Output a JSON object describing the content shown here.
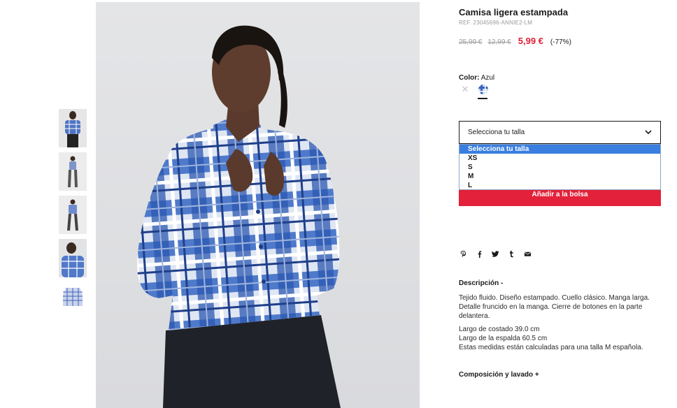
{
  "product": {
    "title": "Camisa ligera estampada",
    "ref": "REF. 23045696-ANNIE2-LM",
    "price_original": "25,99 €",
    "price_previous": "12,99 €",
    "price_sale": "5,99 €",
    "discount": "(-77%)"
  },
  "color": {
    "label": "Color:",
    "value": "Azul"
  },
  "size_select": {
    "current": "Selecciona tu talla",
    "options": [
      "Selecciona tu talla",
      "XS",
      "S",
      "M",
      "L"
    ]
  },
  "add_button": "Añadir a la bolsa",
  "share_icons": [
    "pinterest-icon",
    "facebook-icon",
    "twitter-icon",
    "tumblr-icon",
    "email-icon"
  ],
  "description": {
    "heading": "Descripción -",
    "paragraph": "Tejido fluido. Diseño estampado. Cuello clásico. Manga larga. Detalle fruncido en la manga. Cierre de botones en la parte delantera.",
    "measures": [
      "Largo de costado 39.0 cm",
      "Largo de la espalda 60.5 cm",
      "Estas medidas están calculadas para una talla M española."
    ]
  },
  "composition_heading": "Composición y lavado +",
  "colors": {
    "sale_red": "#e01e37",
    "button_red": "#e3213a",
    "select_highlight": "#3a7fe0",
    "shirt_blue": "#2d5fbf"
  }
}
